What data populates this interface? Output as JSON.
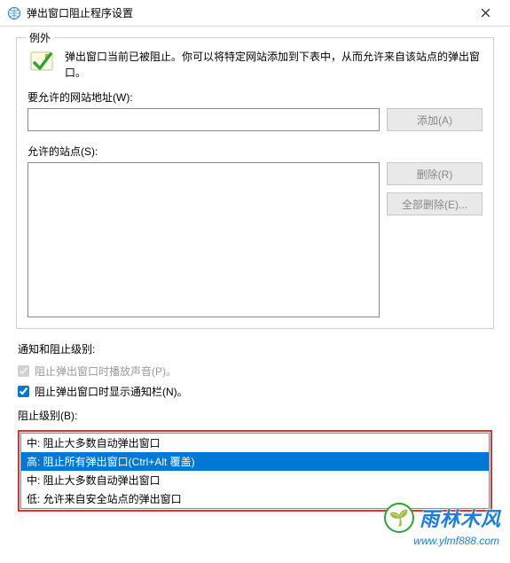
{
  "titlebar": {
    "title": "弹出窗口阻止程序设置"
  },
  "groupbox": {
    "label": "例外",
    "info_text": "弹出窗口当前已被阻止。你可以将特定网站添加到下表中，从而允许来自该站点的弹出窗口。",
    "address_label": "要允许的网站地址(W):",
    "address_value": "",
    "btn_add": "添加(A)",
    "sites_label": "允许的站点(S):",
    "btn_remove": "删除(R)",
    "btn_remove_all": "全部删除(E)..."
  },
  "notify": {
    "section_title": "通知和阻止级别:",
    "cb_sound_label": "阻止弹出窗口时播放声音(P)。",
    "cb_notify_label": "阻止弹出窗口时显示通知栏(N)。",
    "level_label": "阻止级别(B):"
  },
  "dropdown": {
    "items": [
      "中: 阻止大多数自动弹出窗口",
      "高: 阻止所有弹出窗口(Ctrl+Alt 覆盖)",
      "中: 阻止大多数自动弹出窗口",
      "低: 允许来自安全站点的弹出窗口"
    ],
    "selected_index": 1
  },
  "watermark": {
    "brand": "雨林木风",
    "url": "www.ylmf888.com"
  }
}
